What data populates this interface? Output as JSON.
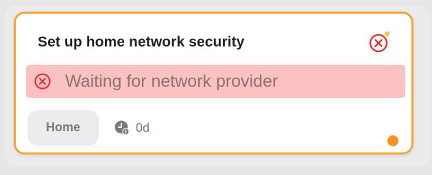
{
  "card": {
    "title": "Set up home network security",
    "dismiss_icon": "close-circle-icon",
    "accent_color": "#f5a431"
  },
  "banner": {
    "text": "Waiting for network provider",
    "icon": "close-circle-icon",
    "background_color": "#fcc2c2",
    "icon_color": "#e0303a"
  },
  "footer": {
    "tag_label": "Home",
    "age_icon": "clock-icon",
    "age_text": "0d",
    "status_dot_color": "#f5941d"
  }
}
